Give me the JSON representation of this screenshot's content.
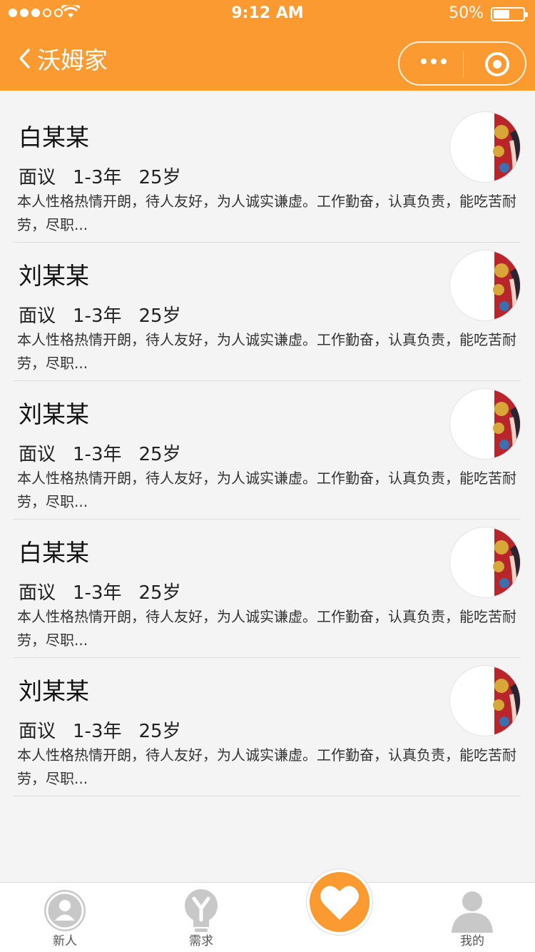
{
  "status_bar": {
    "time": "9:12 AM",
    "battery": "50%"
  },
  "nav": {
    "title": "沃姆家"
  },
  "candidates": [
    {
      "name": "白某某",
      "salary": "面议",
      "experience": "1-3年",
      "age": "25岁",
      "intro": "本人性格热情开朗，待人友好，为人诚实谦虚。工作勤奋，认真负责，能吃苦耐劳，尽职..."
    },
    {
      "name": "刘某某",
      "salary": "面议",
      "experience": "1-3年",
      "age": "25岁",
      "intro": "本人性格热情开朗，待人友好，为人诚实谦虚。工作勤奋，认真负责，能吃苦耐劳，尽职..."
    },
    {
      "name": "刘某某",
      "salary": "面议",
      "experience": "1-3年",
      "age": "25岁",
      "intro": "本人性格热情开朗，待人友好，为人诚实谦虚。工作勤奋，认真负责，能吃苦耐劳，尽职..."
    },
    {
      "name": "白某某",
      "salary": "面议",
      "experience": "1-3年",
      "age": "25岁",
      "intro": "本人性格热情开朗，待人友好，为人诚实谦虚。工作勤奋，认真负责，能吃苦耐劳，尽职..."
    },
    {
      "name": "刘某某",
      "salary": "面议",
      "experience": "1-3年",
      "age": "25岁",
      "intro": "本人性格热情开朗，待人友好，为人诚实谦虚。工作勤奋，认真负责，能吃苦耐劳，尽职..."
    }
  ],
  "tabbar": {
    "tabs": [
      {
        "label": "新人",
        "icon": "person-icon"
      },
      {
        "label": "需求",
        "icon": "bulb-icon"
      },
      {
        "label": "",
        "icon": "heart-icon"
      },
      {
        "label": "我的",
        "icon": "user-icon"
      }
    ]
  },
  "colors": {
    "accent": "#fa9a30",
    "background": "#f4f4f4",
    "tab_icon": "#c8c8c8"
  }
}
